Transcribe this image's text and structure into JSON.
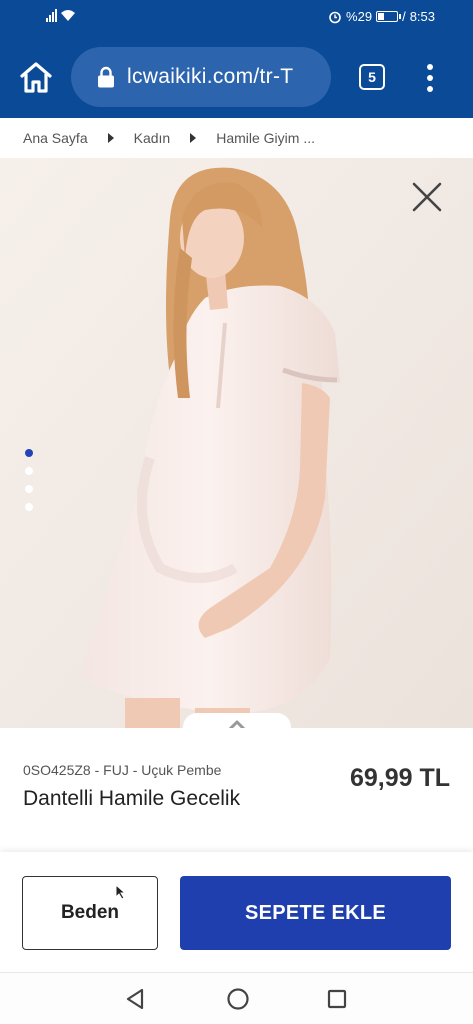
{
  "status_bar": {
    "battery_label": "%29",
    "time": "8:53",
    "battery_level": 0.29
  },
  "browser": {
    "url": "lcwaikiki.com/tr-T",
    "tab_count": "5"
  },
  "breadcrumb": {
    "items": [
      "Ana Sayfa",
      "Kadın",
      "Hamile Giyim ..."
    ]
  },
  "gallery": {
    "image_count": 4,
    "active_index": 0
  },
  "product": {
    "sku": "0SO425Z8 - FUJ - Uçuk Pembe",
    "name": "Dantelli Hamile Gecelik",
    "price": "69,99 TL"
  },
  "actions": {
    "size_label": "Beden",
    "add_to_cart_label": "SEPETE EKLE"
  },
  "colors": {
    "brand_blue": "#0b4a96",
    "cart_button": "#1f3fae",
    "active_dot": "#2244b8"
  }
}
